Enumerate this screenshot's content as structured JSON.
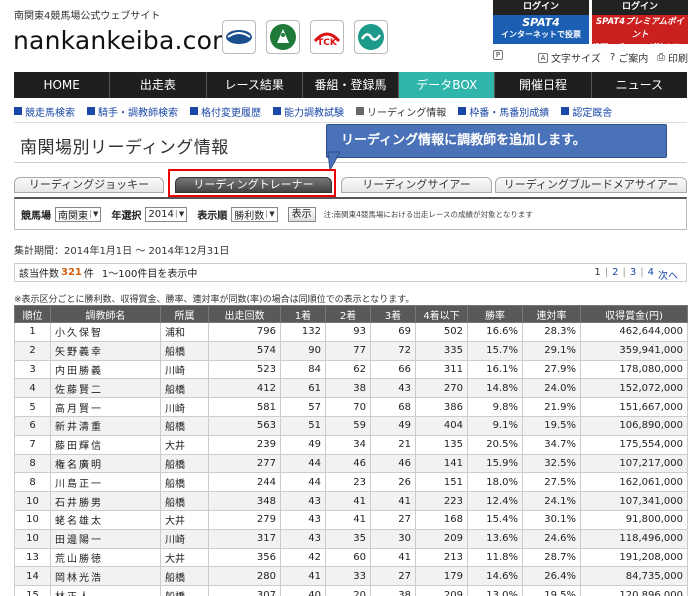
{
  "header": {
    "sub_title": "南関東4競馬場公式ウェブサイト",
    "logo": "nankankeiba.com",
    "org_logos": [
      "urawa-logo-icon",
      "funabashi-logo-icon",
      "tck-logo-icon",
      "kawasaki-logo-icon"
    ],
    "tck_text": "TCK",
    "spat_internet": {
      "login": "ログイン",
      "brand": "SPAT4",
      "label": "インターネットで投票"
    },
    "spat_premium": {
      "login": "ログイン",
      "brand": "SPAT4プレミアムポイント",
      "label": "投票でポイントが貯まる!!"
    },
    "utility": {
      "print_icon": "P",
      "font_size": "文字サイズ",
      "contact": "ご案内",
      "print": "印刷"
    }
  },
  "nav": {
    "items": [
      "HOME",
      "出走表",
      "レース結果",
      "番組・登録馬",
      "データBOX",
      "開催日程",
      "ニュース"
    ],
    "active_index": 4
  },
  "subnav": {
    "items": [
      "競走馬検索",
      "騎手・調教師検索",
      "格付変更履歴",
      "能力調教試験",
      "リーディング情報",
      "枠番・馬番別成績",
      "認定厩舎"
    ],
    "current_index": 4
  },
  "page_title": "南関場別リーディング情報",
  "callout": "リーディング情報に調教師を追加します。",
  "tabs": [
    "リーディングジョッキー",
    "リーディングトレーナー",
    "リーディングサイアー",
    "リーディングブルードメアサイアー"
  ],
  "active_tab": 1,
  "filter": {
    "track_label": "競馬場",
    "track_value": "南関東",
    "year_label": "年選択",
    "year_value": "2014",
    "order_label": "表示順",
    "order_value": "勝利数",
    "show_button": "表示",
    "note": "注:南関東4競馬場における出走レースの成績が対象となります"
  },
  "period": "集計期間：2014年1月1日 〜 2014年12月31日",
  "count": {
    "prefix": "該当件数",
    "value": "321",
    "suffix": "件",
    "display": "1〜100件目を表示中"
  },
  "pager": {
    "current": "1",
    "pages": [
      "2",
      "3",
      "4"
    ],
    "next": "次へ"
  },
  "note": "※表示区分ごとに勝利数、収得賞金、勝率、連対率が同数(率)の場合は同順位での表示となります。",
  "table": {
    "columns": [
      "順位",
      "調教師名",
      "所属",
      "出走回数",
      "1着",
      "2着",
      "3着",
      "4着以下",
      "勝率",
      "連対率",
      "収得賞金(円)"
    ],
    "rows": [
      [
        "1",
        "小久保智",
        "浦和",
        "796",
        "132",
        "93",
        "69",
        "502",
        "16.6%",
        "28.3%",
        "462,644,000"
      ],
      [
        "2",
        "矢野義幸",
        "船橋",
        "574",
        "90",
        "77",
        "72",
        "335",
        "15.7%",
        "29.1%",
        "359,941,000"
      ],
      [
        "3",
        "内田勝義",
        "川崎",
        "523",
        "84",
        "62",
        "66",
        "311",
        "16.1%",
        "27.9%",
        "178,080,000"
      ],
      [
        "4",
        "佐藤賢二",
        "船橋",
        "412",
        "61",
        "38",
        "43",
        "270",
        "14.8%",
        "24.0%",
        "152,072,000"
      ],
      [
        "5",
        "高月賢一",
        "川崎",
        "581",
        "57",
        "70",
        "68",
        "386",
        "9.8%",
        "21.9%",
        "151,667,000"
      ],
      [
        "6",
        "新井清重",
        "船橋",
        "563",
        "51",
        "59",
        "49",
        "404",
        "9.1%",
        "19.5%",
        "106,890,000"
      ],
      [
        "7",
        "藤田輝信",
        "大井",
        "239",
        "49",
        "34",
        "21",
        "135",
        "20.5%",
        "34.7%",
        "175,554,000"
      ],
      [
        "8",
        "権名廣明",
        "船橋",
        "277",
        "44",
        "46",
        "46",
        "141",
        "15.9%",
        "32.5%",
        "107,217,000"
      ],
      [
        "8",
        "川島正一",
        "船橋",
        "244",
        "44",
        "23",
        "26",
        "151",
        "18.0%",
        "27.5%",
        "162,061,000"
      ],
      [
        "10",
        "石井勝男",
        "船橋",
        "348",
        "43",
        "41",
        "41",
        "223",
        "12.4%",
        "24.1%",
        "107,341,000"
      ],
      [
        "10",
        "蛯名雄太",
        "大井",
        "279",
        "43",
        "41",
        "27",
        "168",
        "15.4%",
        "30.1%",
        "91,800,000"
      ],
      [
        "10",
        "田邊陽一",
        "川崎",
        "317",
        "43",
        "35",
        "30",
        "209",
        "13.6%",
        "24.6%",
        "118,496,000"
      ],
      [
        "13",
        "荒山勝徳",
        "大井",
        "356",
        "42",
        "60",
        "41",
        "213",
        "11.8%",
        "28.7%",
        "191,208,000"
      ],
      [
        "14",
        "岡林光浩",
        "船橋",
        "280",
        "41",
        "33",
        "27",
        "179",
        "14.6%",
        "26.4%",
        "84,735,000"
      ],
      [
        "15",
        "林正人",
        "船橋",
        "307",
        "40",
        "20",
        "38",
        "209",
        "13.0%",
        "19.5%",
        "120,896,000"
      ]
    ]
  },
  "colors": {
    "nav_active": "#2fb5ac",
    "callout": "#4a72b8",
    "highlight": "#ee0000",
    "count": "#d4600c"
  }
}
